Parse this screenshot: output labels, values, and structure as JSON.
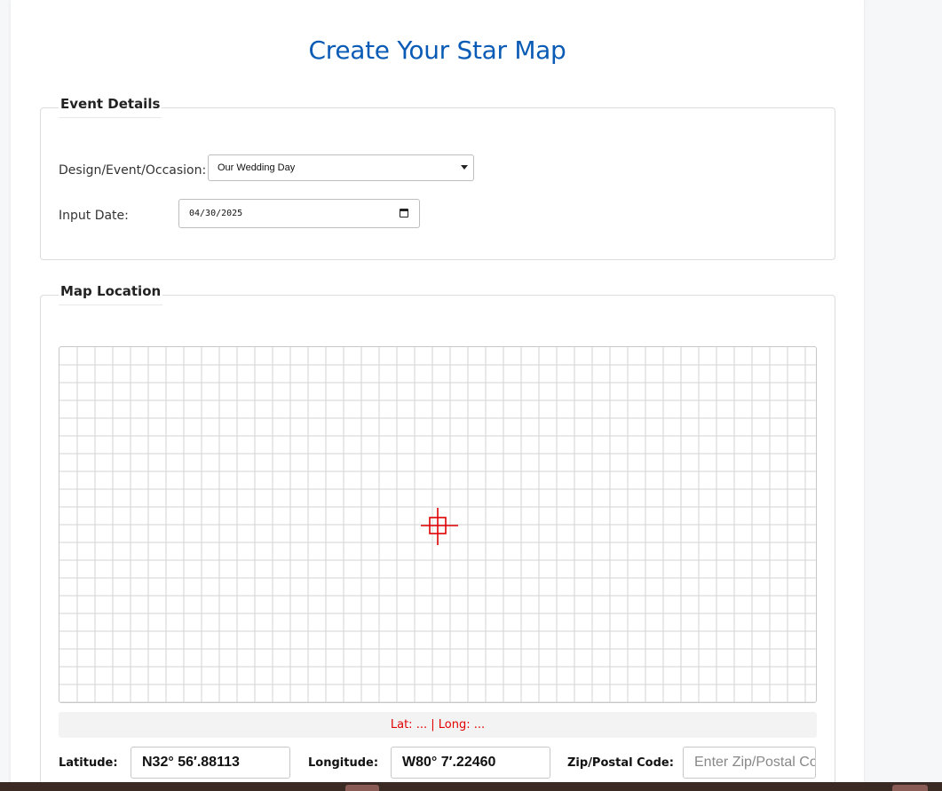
{
  "page": {
    "title": "Create Your Star Map"
  },
  "event_details": {
    "legend": "Event Details",
    "occasion_label": "Design/Event/Occasion:",
    "occasion_value": "Our Wedding Day",
    "date_label": "Input Date:",
    "date_value": "04/30/2025"
  },
  "map_location": {
    "legend": "Map Location",
    "coords_status": "Lat: ... | Long: ...",
    "latitude_label": "Latitude:",
    "latitude_value": "N32° 56′.88113",
    "longitude_label": "Longitude:",
    "longitude_value": "W80° 7′.22460",
    "zip_label": "Zip/Postal Code:",
    "zip_placeholder": "Enter Zip/Postal Code"
  },
  "colors": {
    "title": "#0a5bb5",
    "status_text": "#e00000",
    "crosshair": "#e00000",
    "grid": "#d3d3d3"
  },
  "icons": [
    "chevron-down-icon",
    "calendar-icon",
    "crosshair-icon"
  ]
}
